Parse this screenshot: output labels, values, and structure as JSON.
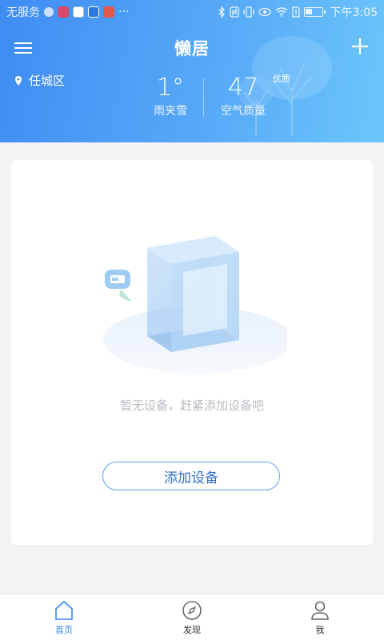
{
  "status_bar": {
    "carrier": "无服务",
    "time": "下午3:05",
    "more": "···"
  },
  "header": {
    "title": "懒居",
    "location": "任城区",
    "weather": {
      "temperature": "1°",
      "condition": "雨夹雪",
      "aqi": "47",
      "aqi_level": "优质",
      "aqi_label": "空气质量"
    }
  },
  "main": {
    "empty_text": "暂无设备，赶紧添加设备吧",
    "add_device_label": "添加设备"
  },
  "bottom_nav": {
    "items": [
      {
        "label": "首页",
        "icon": "home-icon",
        "active": true
      },
      {
        "label": "发现",
        "icon": "compass-icon",
        "active": false
      },
      {
        "label": "我",
        "icon": "person-icon",
        "active": false
      }
    ]
  },
  "colors": {
    "header_start": "#3f8cf3",
    "header_end": "#6cc6fb",
    "accent": "#3a86ee",
    "button_border": "#5a9ff0",
    "empty_text": "#b9bcc2"
  }
}
